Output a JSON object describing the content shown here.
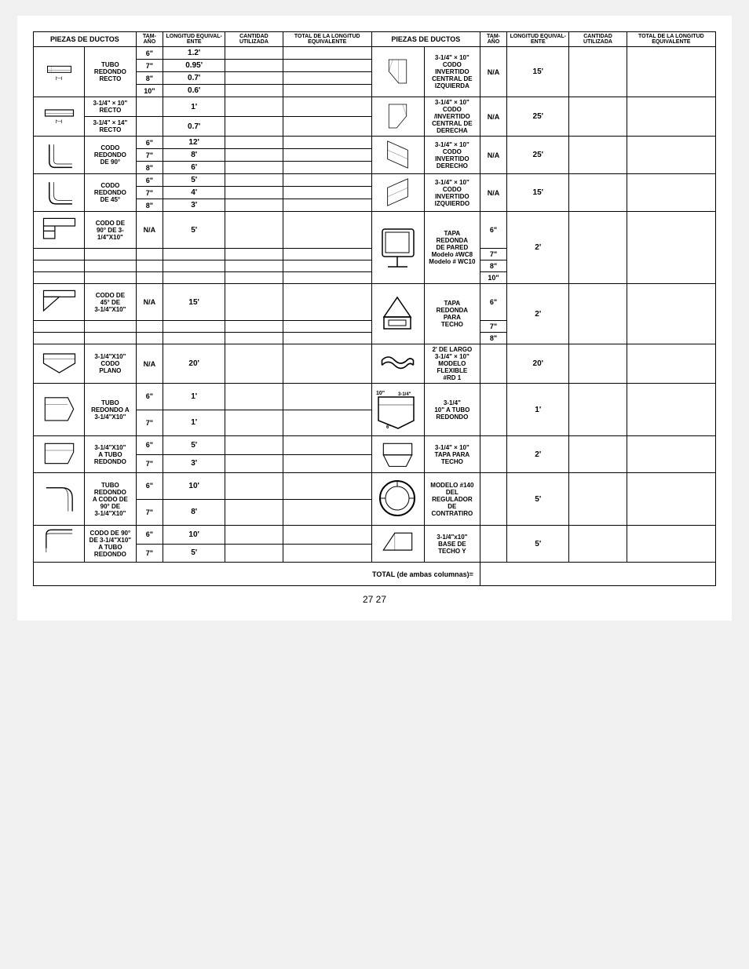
{
  "page": {
    "number": "27 27"
  },
  "headers": {
    "left": {
      "piezas": "PIEZAS DE DUCTOS",
      "tam": "TAM-AÑO",
      "longitud": "LONGITUD EQUIVAL-ENTE",
      "cantidad": "CANTIDAD UTILIZADA",
      "total": "TOTAL DE LA LONGITUD EQUIVALENTE"
    },
    "right": {
      "piezas": "PIEZAS DE DUCTOS",
      "tam": "TAM-AÑO",
      "longitud": "LONGITUD EQUIVAL-ENTE",
      "cantidad": "CANTIDAD UTILIZADA",
      "total": "TOTAL DE LA LONGITUD EQUIVALENTE"
    }
  },
  "rows": [
    {
      "left": {
        "desc": "TUBO\nREDONDO\nRECTO",
        "sizes": [
          "6\"",
          "7\"",
          "8\"",
          "10\""
        ],
        "values": [
          "1.2'",
          "0.95'",
          "0.7'",
          "0.6'"
        ]
      },
      "right": {
        "desc": "3-1/4\" x 10\"\nCODO\nINVERTIDO\nCENTRAL DE\nIZQUIERDA",
        "tam": "N/A",
        "value": "15'"
      }
    },
    {
      "left": {
        "desc1": "3-1/4\" x 10\"\nRECTO",
        "size1": "",
        "val1": "1'",
        "desc2": "3-1/4\" x 14\"\nRECTO",
        "size2": "",
        "val2": "0.7'"
      },
      "right": {
        "desc": "3-1/4\" x 10\"\nCODO\n/INVERTIDO\nCENTRAL DE\nDERECHA",
        "tam": "N/A",
        "value": "25'"
      }
    },
    {
      "left": {
        "desc": "CODO\nREDONDO\nDE 90°",
        "sizes": [
          "6\"",
          "7\"",
          "8\""
        ],
        "values": [
          "12'",
          "8'",
          "6'"
        ]
      },
      "right": {
        "desc": "3-1/4\" x 10\"\nCODO\nINVERTIDO\nDERECHO",
        "tam": "N/A",
        "value": "25'"
      }
    },
    {
      "left": {
        "desc": "CODO\nREDONDO\nDE 45°",
        "sizes": [
          "6\"",
          "7\"",
          "8\""
        ],
        "values": [
          "5'",
          "4'",
          "3'"
        ]
      },
      "right": {
        "desc": "3-1/4\" x 10\"\nCODO\nINVERTIDO\nIZQUIERDO",
        "tam": "N/A",
        "value": "15'"
      }
    },
    {
      "left": {
        "desc": "CODO DE\n90° DE 3-1/4\"X10\"",
        "tam": "N/A",
        "value": "5'"
      },
      "right": {
        "desc": "TAPA\nREDONDA\nDE PARED\nModelo #WC8\nModelo # WC10",
        "sizes": [
          "6\"",
          "7\"",
          "8\"",
          "10\""
        ],
        "value": "2'"
      }
    },
    {
      "left": {
        "desc": "CODO DE\n45° DE\n3-1/4\"X10\"",
        "tam": "N/A",
        "value": "15'"
      },
      "right": {
        "desc": "TAPA\nREDONDA\nPARA\nTECHO",
        "sizes": [
          "6\"",
          "7\"",
          "8\""
        ],
        "value": "2'"
      }
    },
    {
      "left": {
        "desc": "3-1/4\"X10\"\nCODO\nPLANO",
        "tam": "N/A",
        "value": "20'"
      },
      "right": {
        "desc": "2' DE LARGO\n3-1/4\" x 10\"\nMODELO\nFLEXIBLE\n#RD 1",
        "value": "20'"
      }
    },
    {
      "left": {
        "desc": "TUBO\nREDONDO A\n3-1/4\"X10\"",
        "sizes": [
          "6\"",
          "7\""
        ],
        "values": [
          "1'",
          "1'"
        ]
      },
      "right": {
        "desc": "3-1/4\"\n10\" A TUBO\nREDONDO",
        "value": "1'"
      }
    },
    {
      "left": {
        "desc": "3-1/4\"X10\"\nA TUBO\nREDONDO",
        "sizes": [
          "6\"",
          "7\""
        ],
        "values": [
          "5'",
          "3'"
        ]
      },
      "right": {
        "desc": "3-1/4\" x 10\"\nTAPA PARA\nTECHO",
        "value": "2'"
      }
    },
    {
      "left": {
        "desc": "TUBO\nREDONDO\nA CODO DE\n90° DE\n3-1/4\"X10\"",
        "sizes": [
          "6\"",
          "7\""
        ],
        "values": [
          "10'",
          "8'"
        ]
      },
      "right": {
        "desc": "MODELO #140\nDEL REGULADOR\nDE CONTRATIRO",
        "value": "5'"
      }
    },
    {
      "left": {
        "desc": "CODO DE 90°\nDE 3-1/4\"X10\"\nA TUBO\nREDONDO",
        "sizes": [
          "6\"",
          "7\""
        ],
        "values": [
          "10'",
          "5'"
        ]
      },
      "right": {
        "desc": "3-1/4\"x10\"\nBASE DE\nTECHO Y",
        "value": "5'"
      }
    }
  ],
  "footer": {
    "total_label": "TOTAL (de ambas columnas)="
  }
}
